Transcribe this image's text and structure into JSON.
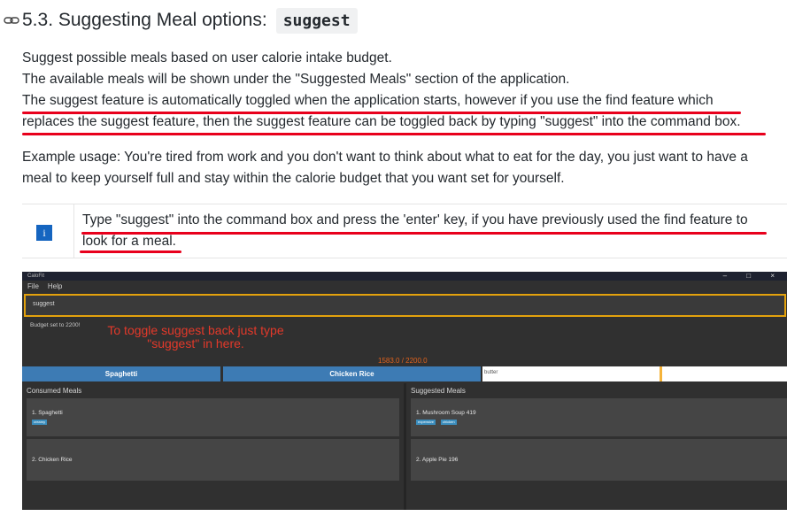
{
  "heading": {
    "title": "5.3. Suggesting Meal options:",
    "code": "suggest"
  },
  "para1": {
    "l1": "Suggest possible meals based on user calorie intake budget.",
    "l2": "The available meals will be shown under the \"Suggested Meals\" section of the application.",
    "l3": "The suggest feature is automatically toggled when the application starts, however if you use the find feature which",
    "l4": "replaces the suggest feature, then the suggest feature can be toggled back by typing \"suggest\" into the command box."
  },
  "para2": {
    "l1": "Example usage: You're tired from work and you don't want to think about what to eat for the day, you just want to have a",
    "l2": "meal to keep yourself full and stay within the calorie budget that you want set for yourself."
  },
  "tip": {
    "icon": "i",
    "l1": "Type \"suggest\" into the command box and press the 'enter' key, if you have previously used the find feature to",
    "l2": "look for a meal."
  },
  "app": {
    "title": "CaloFit",
    "controls": "– □ ×",
    "menu": [
      "File",
      "Help"
    ],
    "command": "suggest",
    "result": "Budget set to 2200!",
    "annotation_l1": "To toggle suggest back just type",
    "annotation_l2": "\"suggest\" in here.",
    "budget": "1583.0 / 2200.0",
    "bar_meals": [
      "Spaghetti",
      "Chicken Rice"
    ],
    "bar_extra": "butter",
    "consumed_title": "Consumed Meals",
    "suggested_title": "Suggested Meals",
    "consumed": [
      {
        "name": "1.  Spaghetti",
        "tag": "creamy"
      },
      {
        "name": "2.  Chicken Rice",
        "tag": ""
      }
    ],
    "suggested": [
      {
        "name": "1.  Mushroom Soup 419",
        "tags": [
          "expensive",
          "chicken"
        ]
      },
      {
        "name": "2.  Apple Pie 196",
        "tags": []
      }
    ]
  },
  "colors": {
    "underline": "#e8001c",
    "accent": "#e3a10c",
    "bar": "#3d7bb4",
    "annotation": "#e3392a"
  }
}
